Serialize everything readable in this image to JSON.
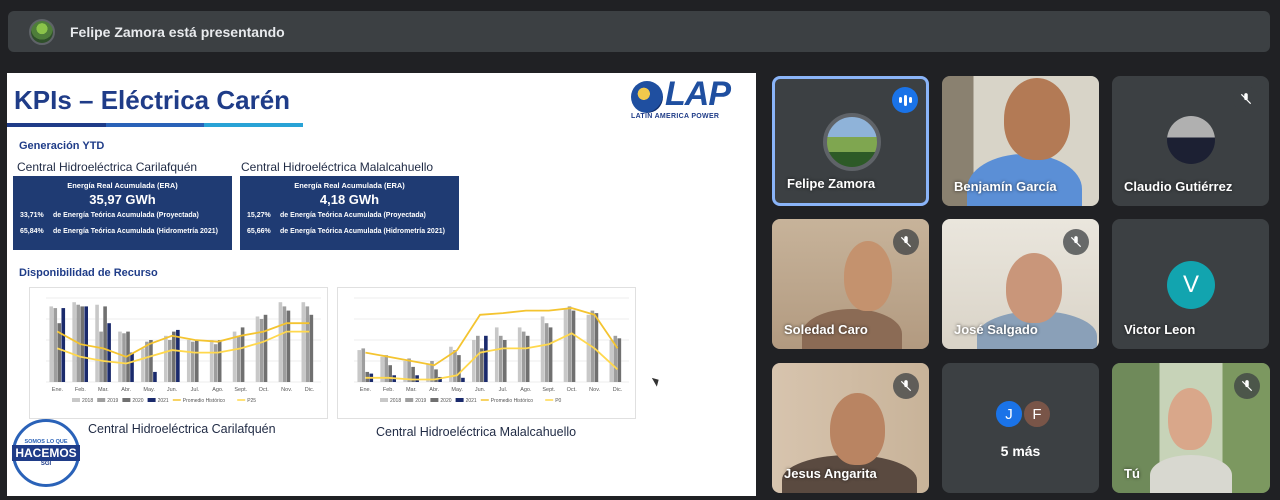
{
  "topbar": {
    "presenting_text": "Felipe Zamora está presentando"
  },
  "slide": {
    "title": "KPIs – Eléctrica Carén",
    "logo": {
      "name": "LAP",
      "subtitle": "LATIN AMERICA POWER"
    },
    "generacion_label": "Generación YTD",
    "plants": [
      {
        "name": "Central Hidroeléctrica Carilafquén",
        "era_label": "Energía Real Acumulada (ERA)",
        "era_value": "35,97 GWh",
        "pct_proyectada": "33,71%",
        "desc_proyectada": "de Energía Teórica Acumulada (Proyectada)",
        "pct_hidrometria": "65,84%",
        "desc_hidrometria": "de Energía Teórica Acumulada (Hidrometría 2021)"
      },
      {
        "name": "Central Hidroeléctrica Malalcahuello",
        "era_label": "Energía Real Acumulada (ERA)",
        "era_value": "4,18 GWh",
        "pct_proyectada": "15,27%",
        "desc_proyectada": "de Energía Teórica Acumulada (Proyectada)",
        "pct_hidrometria": "65,66%",
        "desc_hidrometria": "de Energía Teórica Acumulada (Hidrometría 2021)"
      }
    ],
    "disponibilidad_label": "Disponibilidad de Recurso",
    "badge": {
      "top": "SOMOS LO QUE",
      "main": "HACEMOS",
      "sub": "SGI"
    },
    "colors": {
      "navy": "#1f3b73",
      "title": "#1f3c88"
    }
  },
  "chart_data": [
    {
      "type": "bar",
      "caption": "Central Hidroeléctrica Carilafquén",
      "categories": [
        "Ene.",
        "Feb.",
        "Mar.",
        "Abr.",
        "May.",
        "Jun.",
        "Jul.",
        "Ago.",
        "Sept.",
        "Oct.",
        "Nov.",
        "Dic."
      ],
      "ylim": [
        0,
        100
      ],
      "series": [
        {
          "name": "2018",
          "kind": "bar",
          "color": "#c8c8c8",
          "values": [
            90,
            95,
            92,
            60,
            40,
            55,
            50,
            50,
            60,
            78,
            95,
            95
          ]
        },
        {
          "name": "2019",
          "kind": "bar",
          "color": "#9e9e9e",
          "values": [
            88,
            92,
            60,
            58,
            48,
            50,
            48,
            45,
            55,
            75,
            90,
            90
          ]
        },
        {
          "name": "2020",
          "kind": "bar",
          "color": "#707070",
          "values": [
            70,
            90,
            90,
            60,
            50,
            60,
            50,
            50,
            65,
            80,
            85,
            80
          ]
        },
        {
          "name": "2021",
          "kind": "bar",
          "color": "#1a2a6c",
          "values": [
            88,
            90,
            70,
            35,
            12,
            62,
            0,
            0,
            0,
            0,
            0,
            0
          ]
        },
        {
          "name": "Promedio Histórico",
          "kind": "line",
          "color": "#f4c430",
          "values": [
            60,
            45,
            40,
            30,
            45,
            55,
            50,
            48,
            55,
            60,
            70,
            70
          ]
        },
        {
          "name": "P25",
          "kind": "line",
          "color": "#ffd84d",
          "values": [
            40,
            30,
            25,
            22,
            30,
            38,
            35,
            35,
            40,
            48,
            60,
            60
          ]
        }
      ]
    },
    {
      "type": "bar",
      "caption": "Central Hidroeléctrica Malalcahuello",
      "categories": [
        "Ene.",
        "Feb.",
        "Mar.",
        "Abr.",
        "May.",
        "Jun.",
        "Jul.",
        "Ago.",
        "Sept.",
        "Oct.",
        "Nov.",
        "Dic."
      ],
      "ylim": [
        0,
        100
      ],
      "series": [
        {
          "name": "2018",
          "kind": "bar",
          "color": "#c8c8c8",
          "values": [
            38,
            30,
            25,
            22,
            42,
            50,
            65,
            65,
            78,
            88,
            80,
            50
          ]
        },
        {
          "name": "2019",
          "kind": "bar",
          "color": "#9e9e9e",
          "values": [
            40,
            32,
            28,
            25,
            38,
            55,
            55,
            60,
            70,
            90,
            85,
            55
          ]
        },
        {
          "name": "2020",
          "kind": "bar",
          "color": "#707070",
          "values": [
            12,
            20,
            18,
            15,
            32,
            40,
            50,
            55,
            65,
            85,
            82,
            52
          ]
        },
        {
          "name": "2021",
          "kind": "bar",
          "color": "#1a2a6c",
          "values": [
            10,
            8,
            8,
            6,
            5,
            55,
            0,
            0,
            0,
            0,
            0,
            0
          ]
        },
        {
          "name": "Promedio Histórico",
          "kind": "line",
          "color": "#f4c430",
          "values": [
            35,
            30,
            25,
            20,
            38,
            80,
            82,
            85,
            85,
            88,
            80,
            40
          ]
        },
        {
          "name": "P0",
          "kind": "line",
          "color": "#ffd84d",
          "values": [
            5,
            5,
            3,
            3,
            8,
            35,
            40,
            40,
            45,
            58,
            40,
            15
          ]
        }
      ]
    }
  ],
  "participants": [
    {
      "name": "Felipe Zamora",
      "speaking": true,
      "muted": false
    },
    {
      "name": "Benjamín García",
      "speaking": false,
      "muted": false
    },
    {
      "name": "Claudio Gutiérrez",
      "speaking": false,
      "muted": true
    },
    {
      "name": "Soledad Caro",
      "speaking": false,
      "muted": true
    },
    {
      "name": "José Salgado",
      "speaking": false,
      "muted": true
    },
    {
      "name": "Victor Leon",
      "speaking": false,
      "muted": false,
      "initial": "V"
    },
    {
      "name": "Jesus Angarita",
      "speaking": false,
      "muted": true
    },
    {
      "name": "Tú",
      "speaking": false,
      "muted": true
    }
  ],
  "more": {
    "label": "5 más",
    "initials": [
      "J",
      "F"
    ],
    "colors": [
      "#1a73e8",
      "#795548"
    ]
  }
}
